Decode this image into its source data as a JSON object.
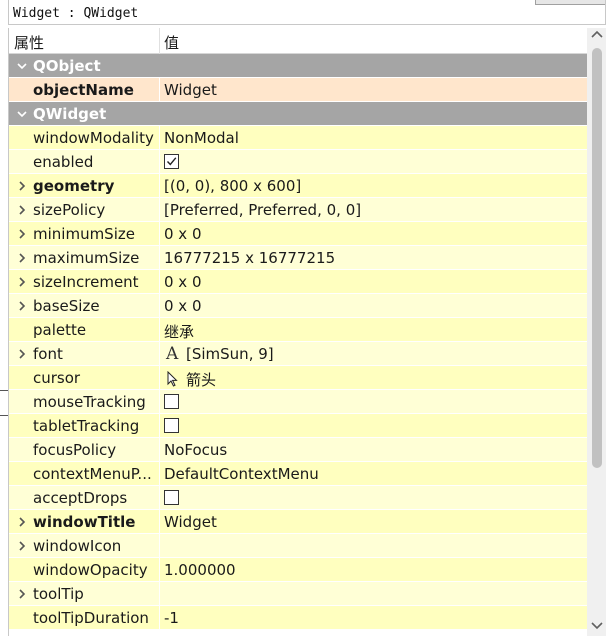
{
  "window": {
    "class_label": "Widget : QWidget"
  },
  "header": {
    "property_col": "属性",
    "value_col": "值"
  },
  "rows": [
    {
      "kind": "group",
      "name": "QObject",
      "expand": "down"
    },
    {
      "kind": "obj",
      "name": "objectName",
      "bold": true,
      "value": "Widget"
    },
    {
      "kind": "group",
      "name": "QWidget",
      "expand": "down"
    },
    {
      "kind": "prop",
      "name": "windowModality",
      "value": "NonModal"
    },
    {
      "kind": "prop",
      "name": "enabled",
      "checkbox": true,
      "checked": true
    },
    {
      "kind": "prop",
      "name": "geometry",
      "bold": true,
      "expand": "right",
      "value": "[(0, 0), 800 x 600]"
    },
    {
      "kind": "prop",
      "name": "sizePolicy",
      "expand": "right",
      "value": "[Preferred, Preferred, 0, 0]"
    },
    {
      "kind": "prop",
      "name": "minimumSize",
      "expand": "right",
      "value": "0 x 0"
    },
    {
      "kind": "prop",
      "name": "maximumSize",
      "expand": "right",
      "value": "16777215 x 16777215"
    },
    {
      "kind": "prop",
      "name": "sizeIncrement",
      "expand": "right",
      "value": "0 x 0"
    },
    {
      "kind": "prop",
      "name": "baseSize",
      "expand": "right",
      "value": "0 x 0"
    },
    {
      "kind": "prop",
      "name": "palette",
      "value": "继承"
    },
    {
      "kind": "prop",
      "name": "font",
      "expand": "right",
      "icon": "font-icon",
      "value": "[SimSun, 9]"
    },
    {
      "kind": "prop",
      "name": "cursor",
      "icon": "arrow-cursor-icon",
      "value": "箭头"
    },
    {
      "kind": "prop",
      "name": "mouseTracking",
      "checkbox": true,
      "checked": false
    },
    {
      "kind": "prop",
      "name": "tabletTracking",
      "checkbox": true,
      "checked": false
    },
    {
      "kind": "prop",
      "name": "focusPolicy",
      "value": "NoFocus"
    },
    {
      "kind": "prop",
      "name": "contextMenuP...",
      "value": "DefaultContextMenu"
    },
    {
      "kind": "prop",
      "name": "acceptDrops",
      "checkbox": true,
      "checked": false
    },
    {
      "kind": "prop",
      "name": "windowTitle",
      "bold": true,
      "expand": "right",
      "value": "Widget"
    },
    {
      "kind": "prop",
      "name": "windowIcon",
      "expand": "right",
      "value": ""
    },
    {
      "kind": "prop",
      "name": "windowOpacity",
      "value": "1.000000"
    },
    {
      "kind": "prop",
      "name": "toolTip",
      "expand": "right",
      "value": ""
    },
    {
      "kind": "prop",
      "name": "toolTipDuration",
      "value": "-1"
    }
  ],
  "colors": {
    "group_bg": "#a5a5a5",
    "prop_bg": "#ffffbf",
    "prop_bg_alt": "#ffffd6",
    "object_bg": "#ffe6cc"
  }
}
